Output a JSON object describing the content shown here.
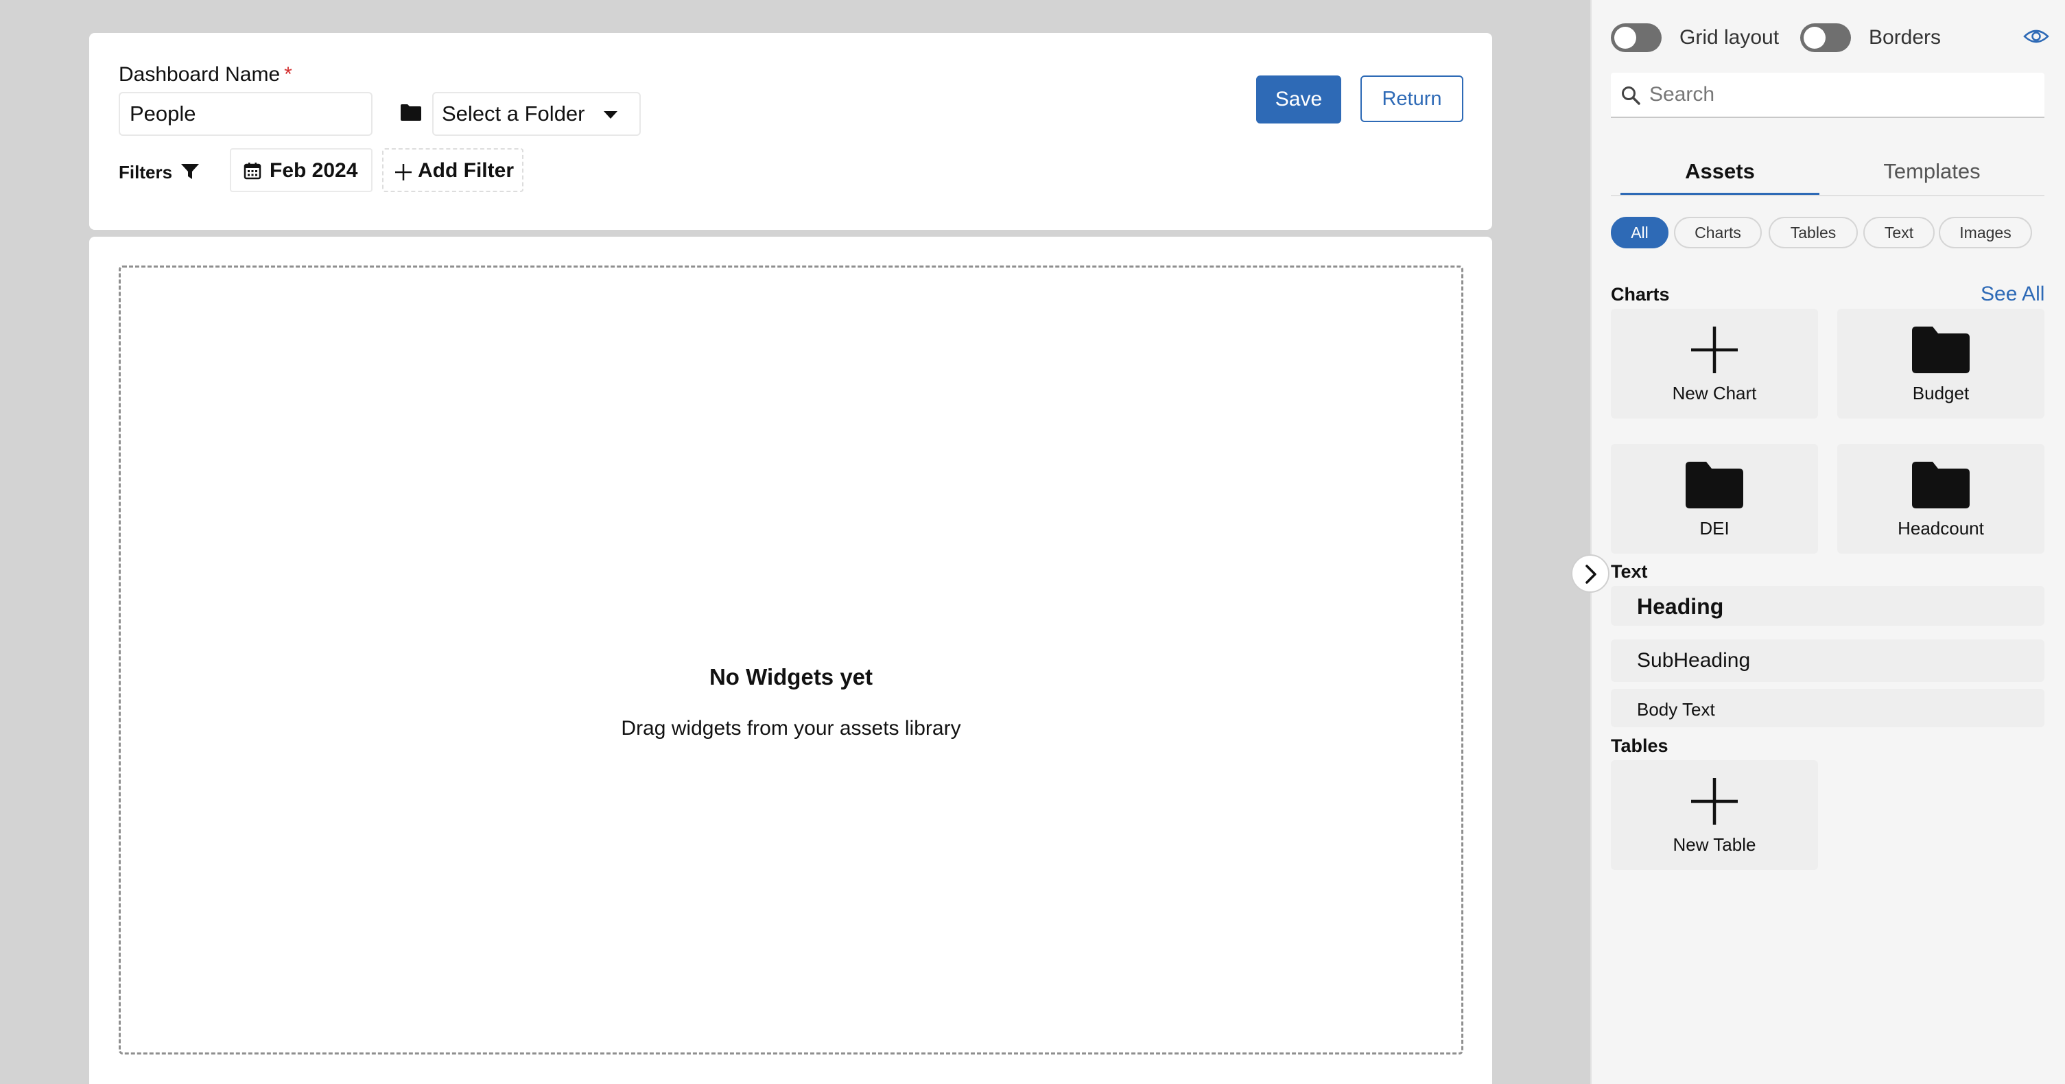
{
  "dashboard": {
    "name_label": "Dashboard Name",
    "required_mark": "*",
    "name_value": "People",
    "folder_placeholder": "Select a Folder",
    "filters_label": "Filters",
    "date_filter": "Feb 2024",
    "add_filter_label": "Add Filter",
    "save_label": "Save",
    "return_label": "Return"
  },
  "canvas": {
    "empty_title": "No Widgets yet",
    "empty_subtitle": "Drag widgets from your assets library"
  },
  "panel": {
    "toggles": [
      {
        "label": "Grid layout",
        "on": false
      },
      {
        "label": "Borders",
        "on": false
      }
    ],
    "search_placeholder": "Search",
    "tabs": [
      {
        "label": "Assets",
        "active": true
      },
      {
        "label": "Templates",
        "active": false
      }
    ],
    "filter_pills": [
      {
        "label": "All",
        "active": true
      },
      {
        "label": "Charts",
        "active": false
      },
      {
        "label": "Tables",
        "active": false
      },
      {
        "label": "Text",
        "active": false
      },
      {
        "label": "Images",
        "active": false
      }
    ],
    "charts_title": "Charts",
    "see_all_label": "See All",
    "charts": [
      {
        "label": "New Chart",
        "icon": "plus-icon"
      },
      {
        "label": "Budget",
        "icon": "folder-icon"
      },
      {
        "label": "DEI",
        "icon": "folder-icon"
      },
      {
        "label": "Headcount",
        "icon": "folder-icon"
      }
    ],
    "text_title": "Text",
    "text_items": [
      {
        "label": "Heading"
      },
      {
        "label": "SubHeading"
      },
      {
        "label": "Body Text"
      }
    ],
    "tables_title": "Tables",
    "tables": [
      {
        "label": "New Table",
        "icon": "plus-icon"
      }
    ]
  },
  "colors": {
    "accent": "#2e6ab6",
    "required": "#d32f2f",
    "page_bg": "#d3d3d3",
    "panel_bg": "#f5f5f5"
  }
}
